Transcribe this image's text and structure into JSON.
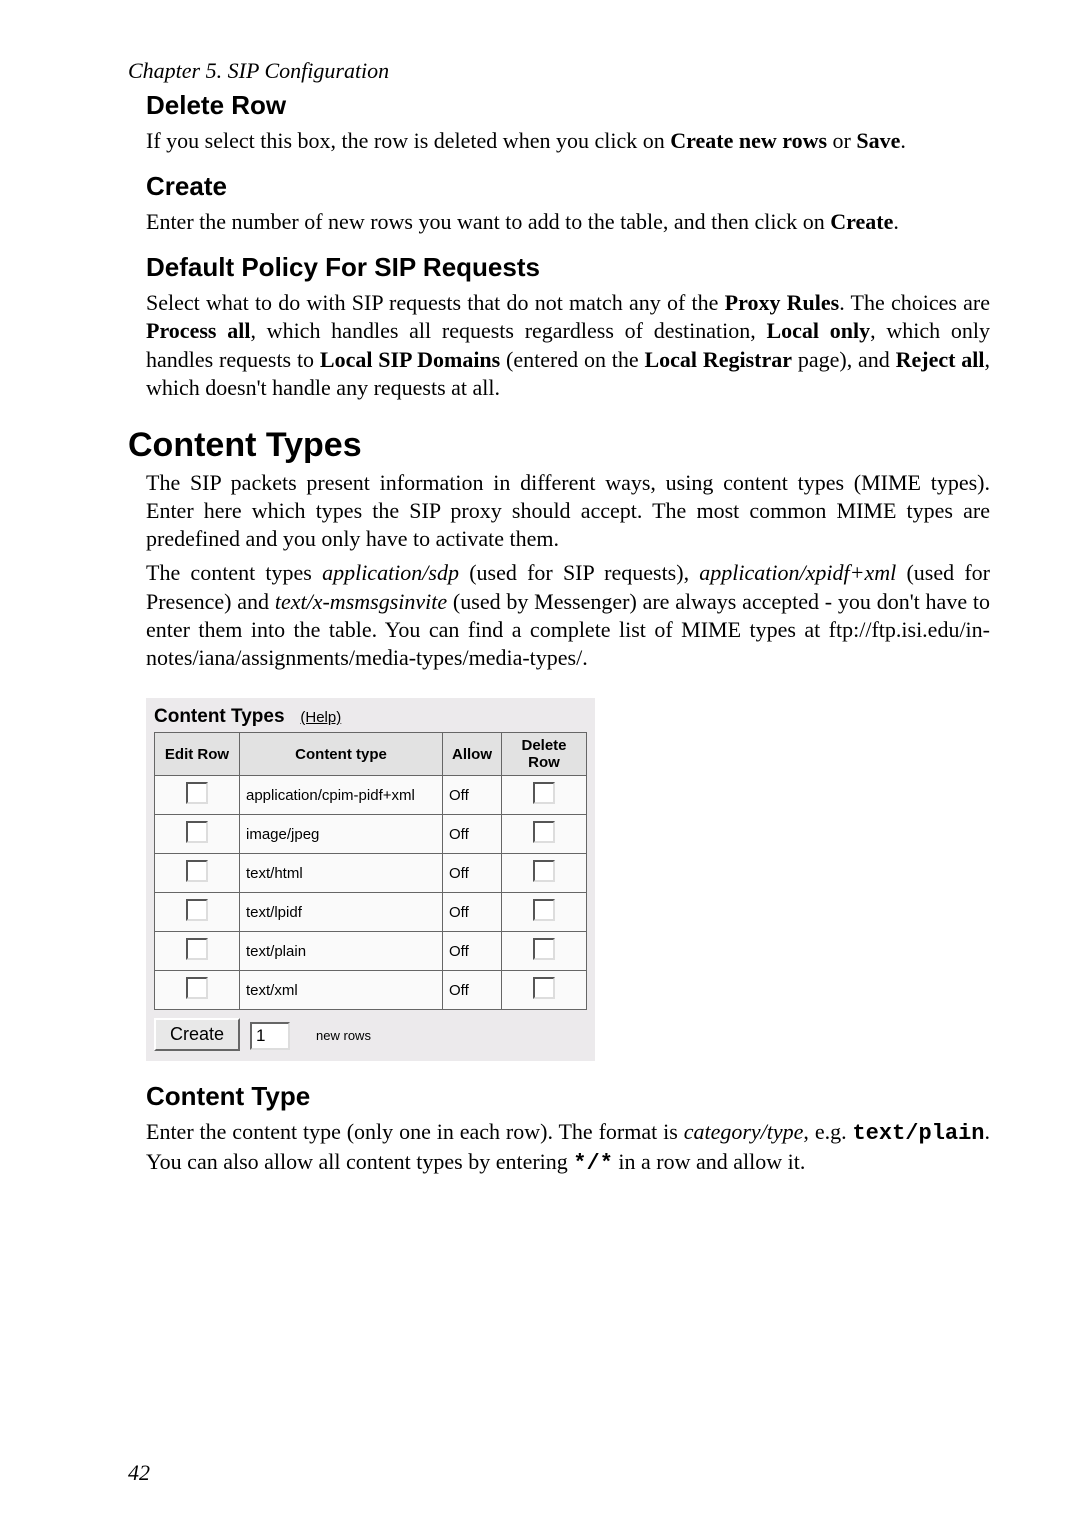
{
  "chapter": "Chapter 5. SIP Configuration",
  "sections": {
    "deleteRow": {
      "title": "Delete Row",
      "p1a": "If you select this box, the row is deleted when you click on ",
      "p1b": "Create new rows",
      "p1c": " or ",
      "p1d": "Save",
      "p1e": "."
    },
    "create": {
      "title": "Create",
      "p1a": "Enter the number of new rows you want to add to the table, and then click on ",
      "p1b": "Create",
      "p1c": "."
    },
    "defaultPolicy": {
      "title": "Default Policy For SIP Requests",
      "p1a": "Select what to do with SIP requests that do not match any of the ",
      "p1b": "Proxy Rules",
      "p1c": ". The choices are ",
      "p1d": "Process all",
      "p1e": ", which handles all requests regardless of destination, ",
      "p1f": "Local only",
      "p1g": ", which only handles requests to ",
      "p1h": "Local SIP Domains",
      "p1i": " (entered on the ",
      "p1j": "Local Registrar",
      "p1k": " page), and ",
      "p1l": "Reject all",
      "p1m": ", which doesn't handle any requests at all."
    },
    "contentTypes": {
      "title": "Content Types",
      "p1": "The SIP packets present information in different ways, using content types (MIME types). Enter here which types the SIP proxy should accept. The most common MIME types are predefined and you only have to activate them.",
      "p2a": "The content types ",
      "p2b": "application/sdp",
      "p2c": " (used for SIP requests), ",
      "p2d": "application/xpidf+xml",
      "p2e": " (used for Presence) and ",
      "p2f": "text/x-msmsgsinvite",
      "p2g": " (used by Messenger) are always accepted - you don't have to enter them into the table. You can find a complete list of MIME types at ftp://ftp.isi.edu/in-notes/iana/assignments/media-types/media-types/."
    },
    "table": {
      "heading": "Content Types",
      "help": "(Help)",
      "headers": {
        "edit": "Edit Row",
        "ctype": "Content type",
        "allow": "Allow",
        "del": "Delete Row"
      },
      "rows": [
        {
          "ctype": "application/cpim-pidf+xml",
          "allow": "Off"
        },
        {
          "ctype": "image/jpeg",
          "allow": "Off"
        },
        {
          "ctype": "text/html",
          "allow": "Off"
        },
        {
          "ctype": "text/lpidf",
          "allow": "Off"
        },
        {
          "ctype": "text/plain",
          "allow": "Off"
        },
        {
          "ctype": "text/xml",
          "allow": "Off"
        }
      ],
      "createBtn": "Create",
      "numVal": "1",
      "newRowsLabel": "new rows"
    },
    "contentType": {
      "title": "Content Type",
      "p1a": "Enter the content type (only one in each row). The format is ",
      "p1b": "category/type",
      "p1c": ", e.g. ",
      "p1d": "text/plain",
      "p1e": ". You can also allow all content types by entering ",
      "p1f": "*/*",
      "p1g": " in a row and allow it."
    }
  },
  "pageNumber": "42"
}
